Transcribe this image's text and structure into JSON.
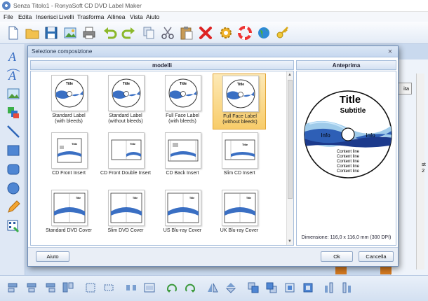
{
  "window": {
    "title": "Senza Titolo1 - RonyaSoft CD DVD Label Maker"
  },
  "menu": [
    "File",
    "Edita",
    "Inserisci",
    "Livelli",
    "Trasforma",
    "Allinea",
    "Vista",
    "Aiuto"
  ],
  "dialog": {
    "title": "Selezione composizione",
    "models_header": "modelli",
    "preview_header": "Anteprima",
    "models": [
      {
        "label": "Standard Label\n(with bleeds)",
        "selected": false
      },
      {
        "label": "Standard Label\n(without bleeds)",
        "selected": false
      },
      {
        "label": "Full Face Label\n(with bleeds)",
        "selected": false
      },
      {
        "label": "Full Face Label\n(without bleeds)",
        "selected": true
      },
      {
        "label": "CD Front Insert",
        "selected": false
      },
      {
        "label": "CD Front Double Insert",
        "selected": false
      },
      {
        "label": "CD Back Insert",
        "selected": false
      },
      {
        "label": "Slim CD Insert",
        "selected": false
      },
      {
        "label": "Standard DVD Cover",
        "selected": false
      },
      {
        "label": "Slim DVD Cover",
        "selected": false
      },
      {
        "label": "US Blu-ray Cover",
        "selected": false
      },
      {
        "label": "UK Blu-ray Cover",
        "selected": false
      }
    ],
    "preview": {
      "title": "Title",
      "subtitle": "Subtitle",
      "info_left": "Info",
      "info_right": "Info",
      "content_lines": [
        "Content line",
        "Content line",
        "Content line",
        "Content line",
        "Content line"
      ]
    },
    "dimension_text": "Dimensione: 116,0 x 116,0 mm (300 DPI)",
    "help_button": "Aiuto",
    "ok_button": "Ok",
    "cancel_button": "Cancella"
  },
  "background": {
    "button_partial": "ita",
    "number_partial": "st 2"
  },
  "colors": {
    "selection": "#f8cc6a",
    "disc_blue": "#1c3a8c",
    "accent": "#4a90d9"
  }
}
